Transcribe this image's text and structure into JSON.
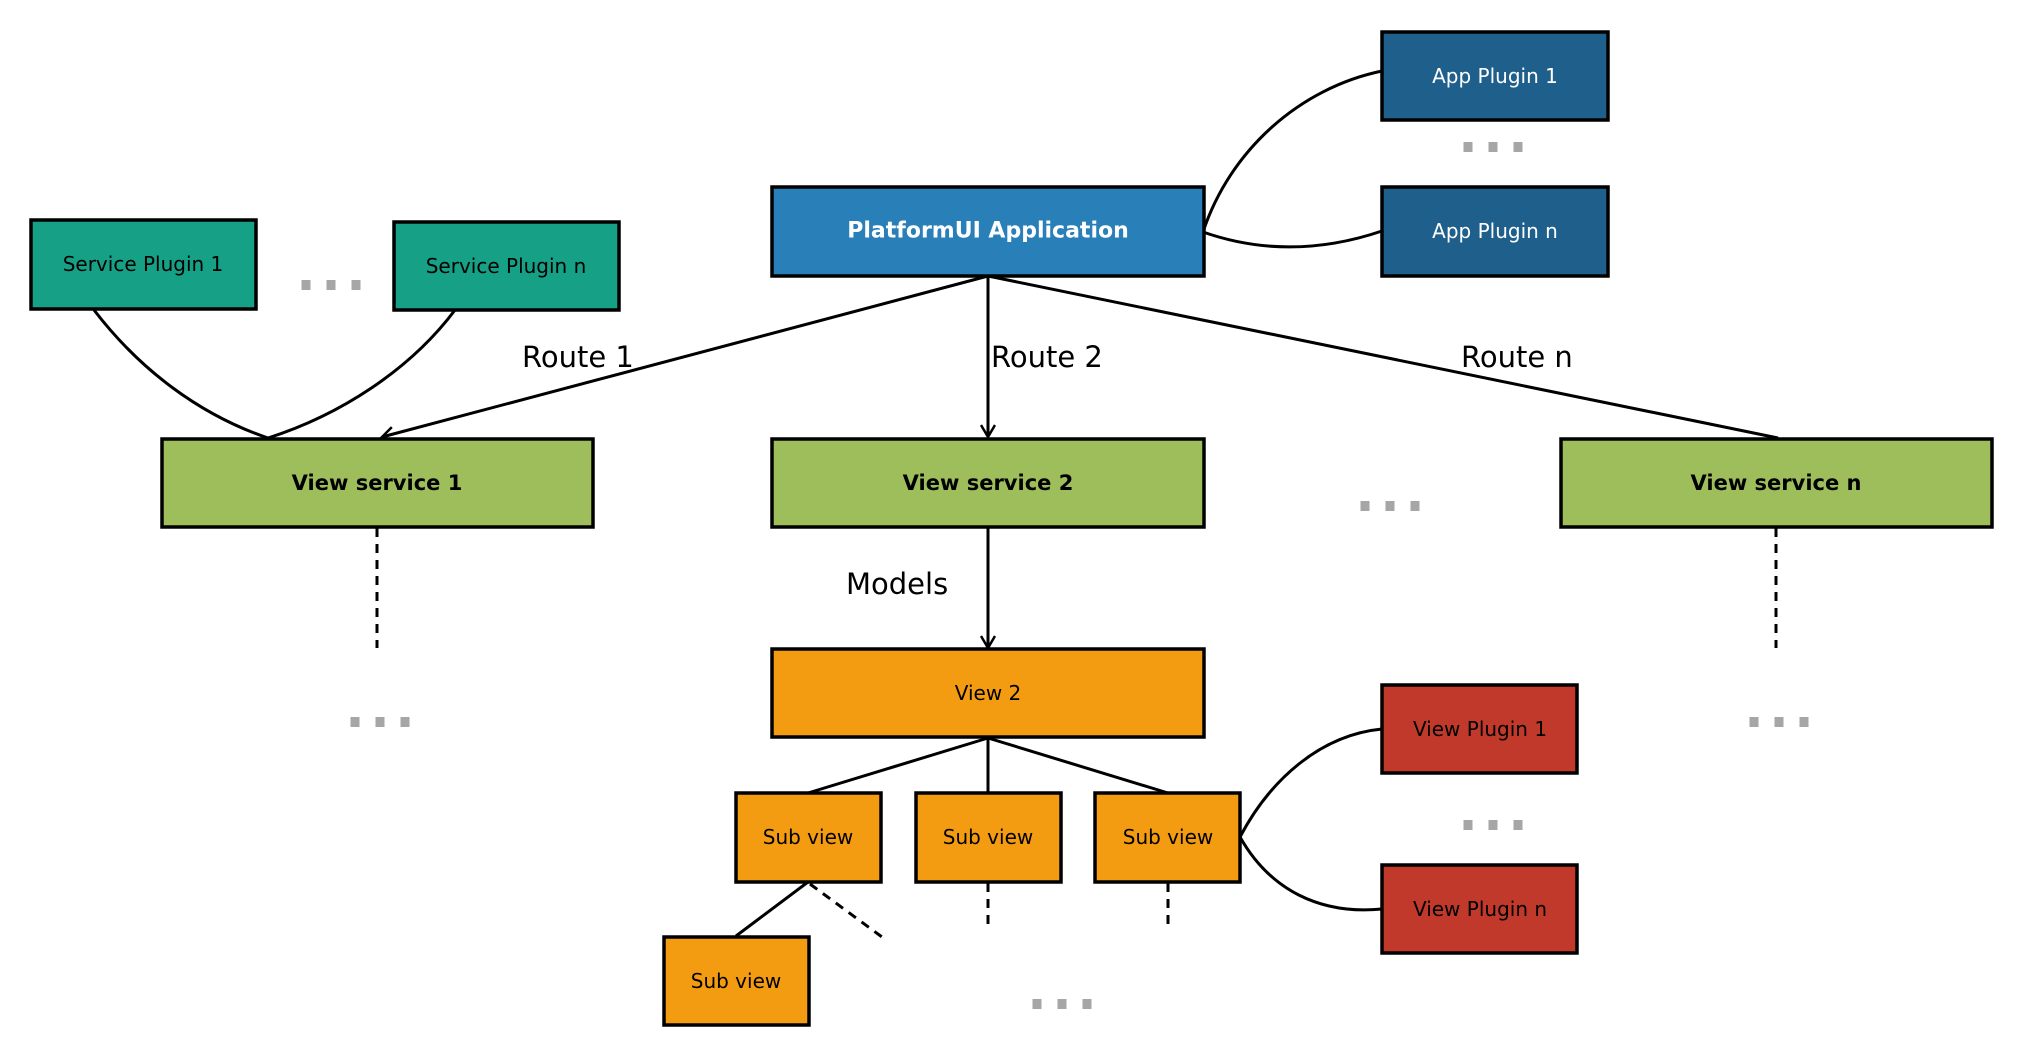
{
  "diagram": {
    "colors": {
      "service_plugin": "#16a085",
      "view_service": "#9ebe5c",
      "application": "#2980b9",
      "app_plugin": "#1f5f8b",
      "view": "#f39c12",
      "view_plugin": "#c0392b",
      "ellipsis": "#a6a6a6",
      "stroke": "#000000",
      "light_text": "#ffffff",
      "dark_text": "#000000"
    },
    "nodes": {
      "application": {
        "label": "PlatformUI Application"
      },
      "app_plugin_1": {
        "label": "App Plugin 1"
      },
      "app_plugin_n": {
        "label": "App Plugin n"
      },
      "service_plugin_1": {
        "label": "Service Plugin 1"
      },
      "service_plugin_n": {
        "label": "Service Plugin n"
      },
      "view_service_1": {
        "label": "View service 1"
      },
      "view_service_2": {
        "label": "View service 2"
      },
      "view_service_n": {
        "label": "View service n"
      },
      "view_2": {
        "label": "View 2"
      },
      "sub_view_a": {
        "label": "Sub view"
      },
      "sub_view_b": {
        "label": "Sub view"
      },
      "sub_view_c": {
        "label": "Sub view"
      },
      "sub_view_d": {
        "label": "Sub view"
      },
      "view_plugin_1": {
        "label": "View Plugin 1"
      },
      "view_plugin_n": {
        "label": "View Plugin n"
      }
    },
    "edge_labels": {
      "route_1": "Route 1",
      "route_2": "Route 2",
      "route_n": "Route n",
      "models": "Models"
    },
    "ellipsis": "..."
  }
}
